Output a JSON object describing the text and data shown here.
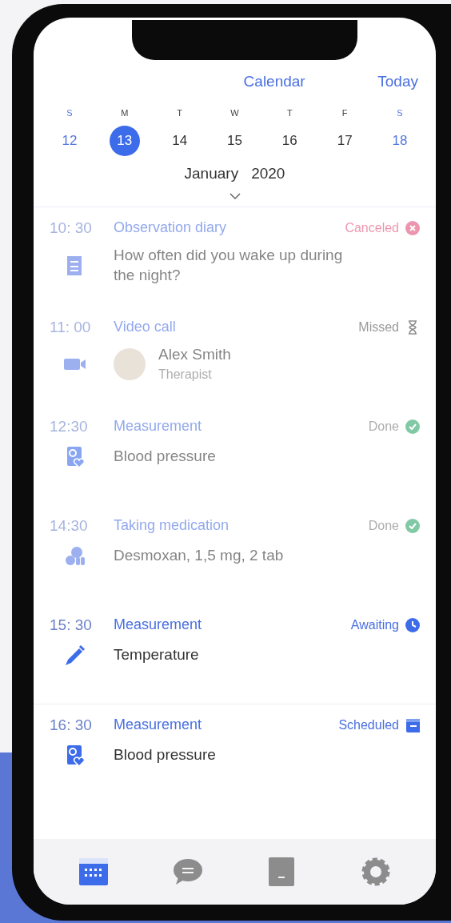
{
  "header": {
    "title": "Calendar",
    "today_button": "Today"
  },
  "week": [
    {
      "letter": "S",
      "number": "12",
      "weekend": true,
      "selected": false
    },
    {
      "letter": "M",
      "number": "13",
      "weekend": false,
      "selected": true
    },
    {
      "letter": "T",
      "number": "14",
      "weekend": false,
      "selected": false
    },
    {
      "letter": "W",
      "number": "15",
      "weekend": false,
      "selected": false
    },
    {
      "letter": "T",
      "number": "16",
      "weekend": false,
      "selected": false
    },
    {
      "letter": "F",
      "number": "17",
      "weekend": false,
      "selected": false
    },
    {
      "letter": "S",
      "number": "18",
      "weekend": true,
      "selected": false
    }
  ],
  "month": "January",
  "year": "2020",
  "events": [
    {
      "time": "10: 30",
      "title": "Observation diary",
      "status": {
        "text": "Canceled",
        "kind": "canceled"
      },
      "past": true,
      "kind": "diary",
      "detail": "How often did you wake up during the night?"
    },
    {
      "time": "11: 00",
      "title": "Video call",
      "status": {
        "text": "Missed",
        "kind": "missed"
      },
      "past": true,
      "kind": "video",
      "person": {
        "name": "Alex Smith",
        "role": "Therapist"
      }
    },
    {
      "time": "12:30",
      "title": "Measurement",
      "status": {
        "text": "Done",
        "kind": "done"
      },
      "past": true,
      "kind": "pressure",
      "detail": "Blood pressure"
    },
    {
      "time": "14:30",
      "title": "Taking medication",
      "status": {
        "text": "Done",
        "kind": "done"
      },
      "past": true,
      "kind": "pills",
      "detail": "Desmoxan, 1,5 mg, 2 tab"
    },
    {
      "time": "15: 30",
      "title": "Measurement",
      "status": {
        "text": "Awaiting",
        "kind": "awaiting"
      },
      "past": false,
      "kind": "thermometer",
      "detail": "Temperature"
    },
    {
      "time": "16: 30",
      "title": "Measurement",
      "status": {
        "text": "Scheduled",
        "kind": "scheduled"
      },
      "past": false,
      "kind": "pressure",
      "detail": "Blood pressure"
    }
  ],
  "tabs": [
    {
      "kind": "calendar",
      "selected": true
    },
    {
      "kind": "chat",
      "selected": false
    },
    {
      "kind": "book",
      "selected": false
    },
    {
      "kind": "settings",
      "selected": false
    }
  ]
}
